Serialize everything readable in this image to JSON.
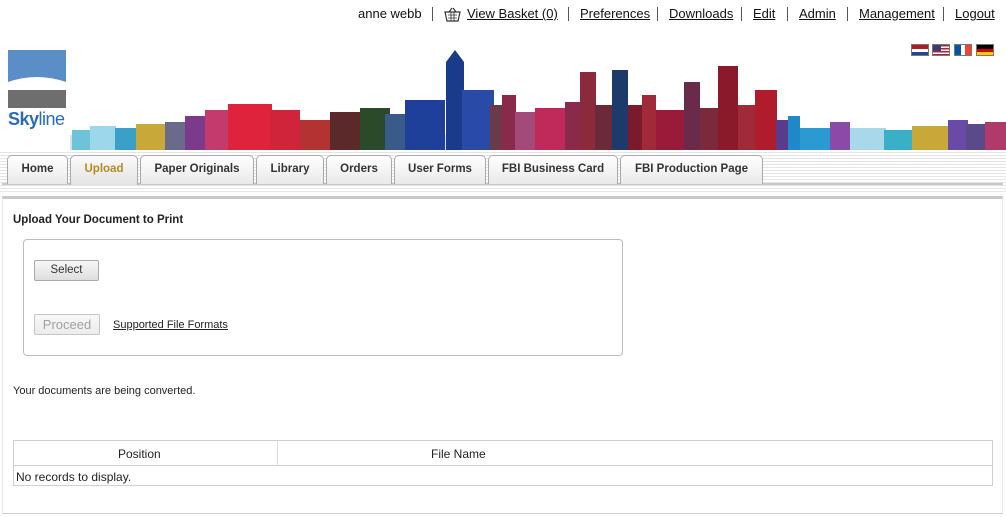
{
  "userbar": {
    "username": "anne webb",
    "basket_label": "View Basket (0)",
    "links": [
      "Preferences",
      "Downloads",
      "Edit",
      "Admin",
      "Management",
      "Logout"
    ]
  },
  "flags": [
    "dutch-flag-icon",
    "us-flag-icon",
    "french-flag-icon",
    "german-flag-icon"
  ],
  "logo": {
    "text_main": "Sky",
    "text_accent": "line"
  },
  "tabs": [
    "Home",
    "Upload",
    "Paper Originals",
    "Library",
    "Orders",
    "User Forms",
    "FBI Business Card",
    "FBI Production Page"
  ],
  "active_tab": "Upload",
  "colors": {
    "active_tab_text": "#b58a1f",
    "logo_blue": "#2a6bb5"
  },
  "upload": {
    "heading": "Upload Your Document to Print",
    "select_label": "Select",
    "proceed_label": "Proceed",
    "formats_link": "Supported File Formats",
    "status": "Your documents are being converted."
  },
  "grid": {
    "columns": [
      "Position",
      "File Name"
    ],
    "empty_text": "No records to display."
  }
}
